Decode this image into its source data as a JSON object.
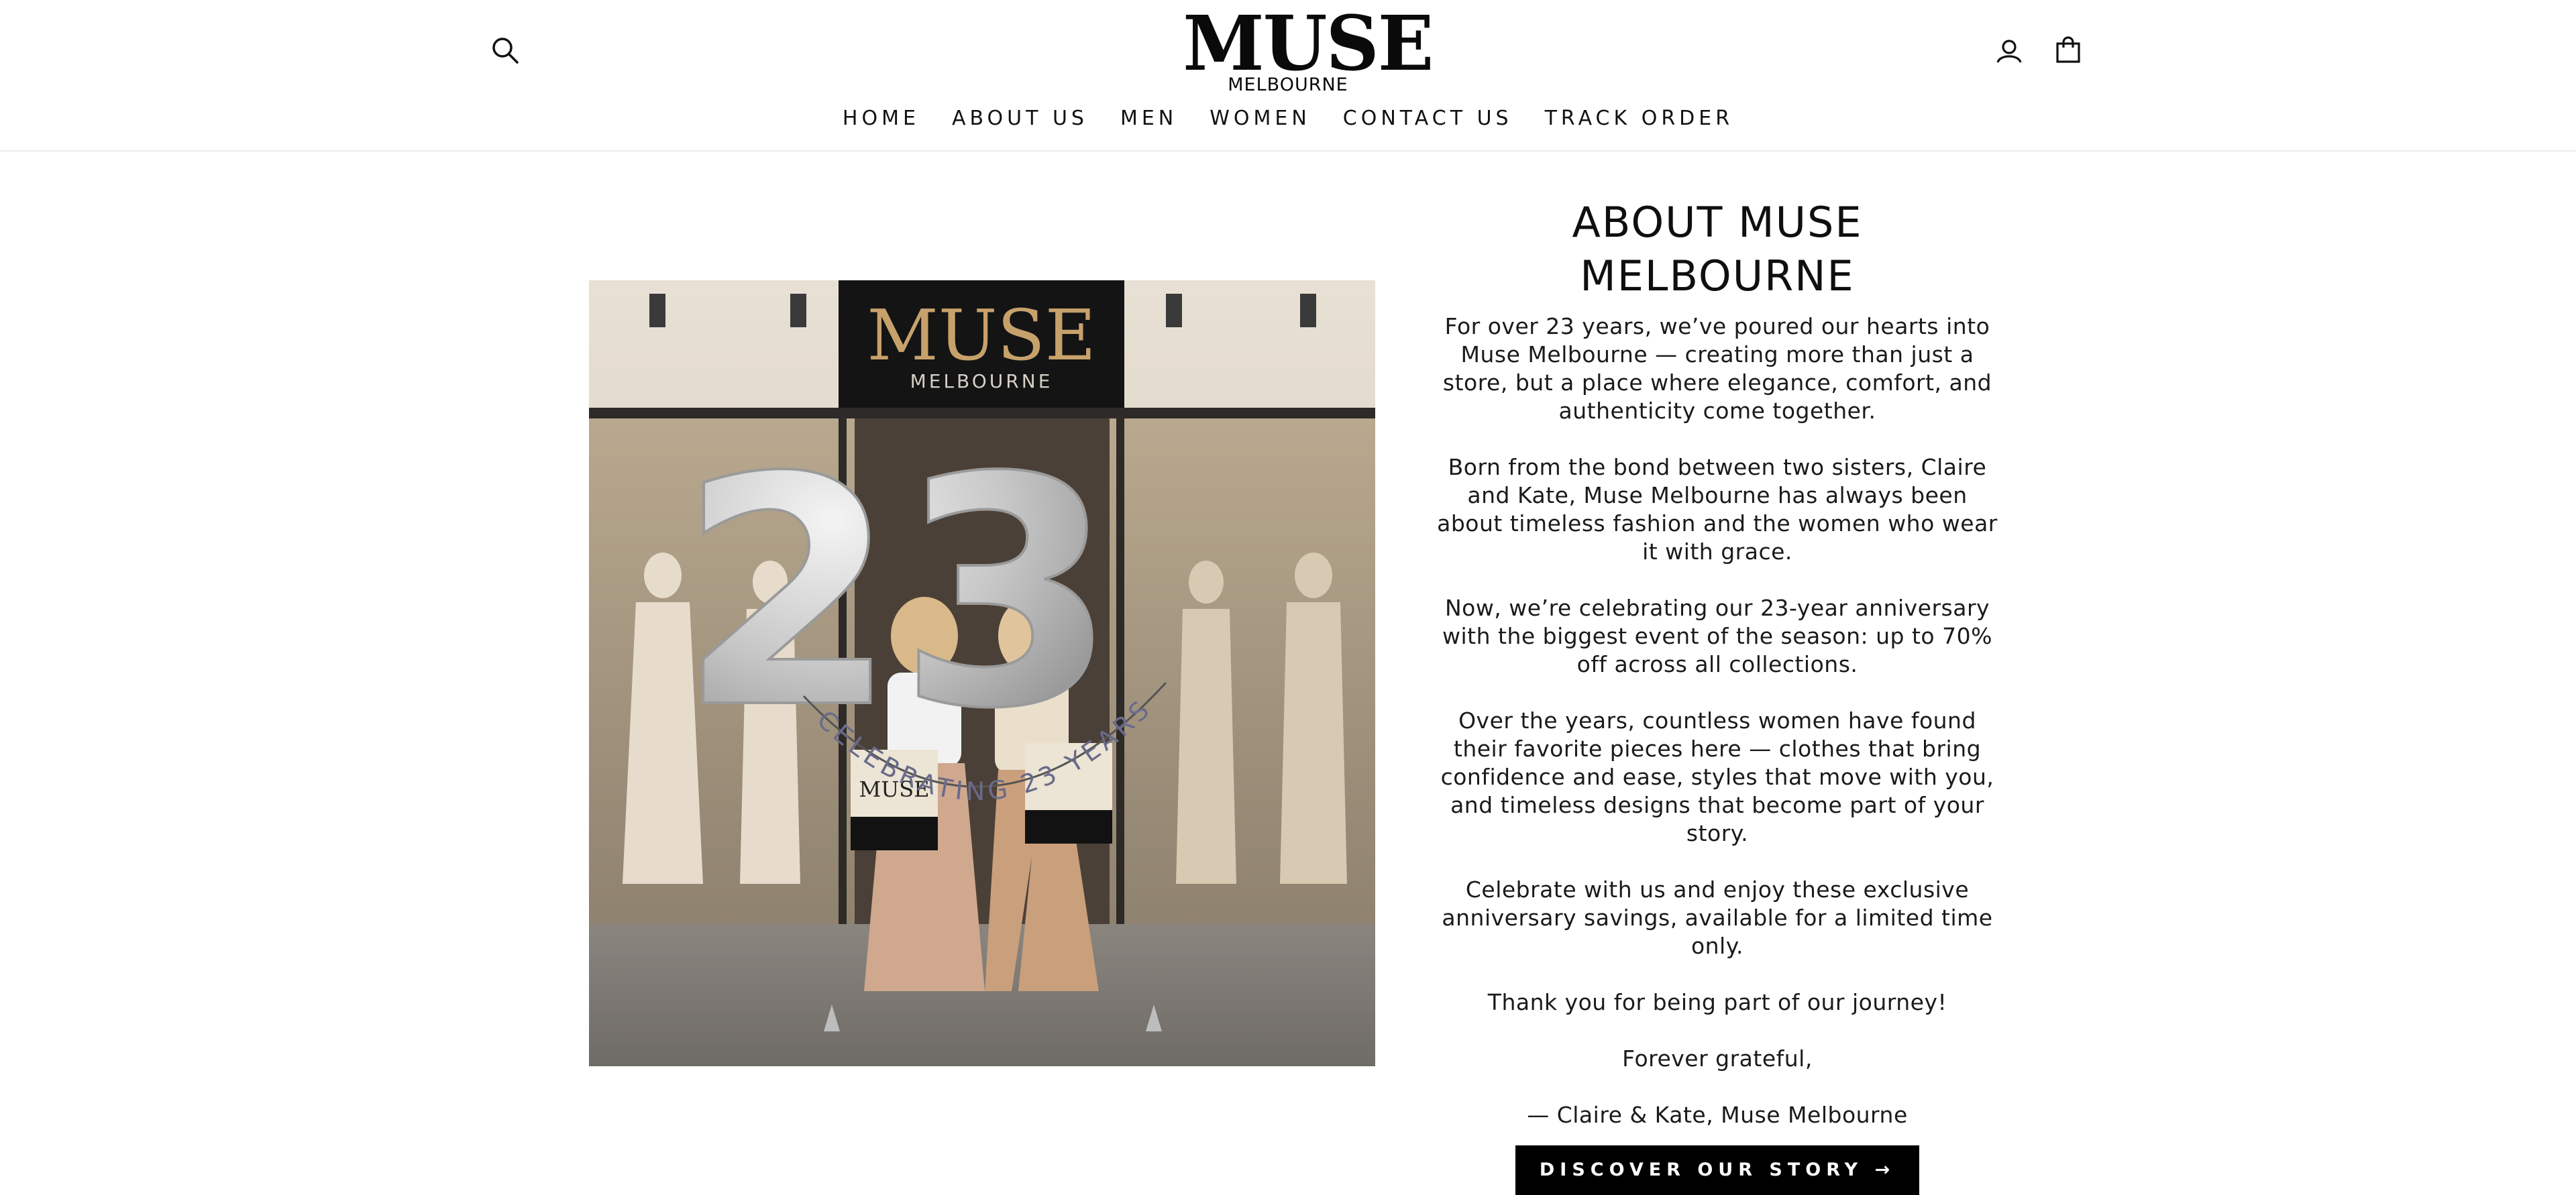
{
  "header": {
    "logo_main": "MUSE",
    "logo_sub": "MELBOURNE",
    "search_icon": "search-icon",
    "account_icon": "account-icon",
    "cart_icon": "shopping-bag-icon"
  },
  "nav": [
    {
      "label": "HOME"
    },
    {
      "label": "ABOUT US"
    },
    {
      "label": "MEN"
    },
    {
      "label": "WOMEN"
    },
    {
      "label": "CONTACT US"
    },
    {
      "label": "TRACK ORDER"
    }
  ],
  "photo": {
    "sign_main": "MUSE",
    "sign_sub": "MELBOURNE",
    "balloons": "23",
    "banner": "CELEBRATING 23 YEARS",
    "bag_text": "MUSE"
  },
  "about": {
    "title": "ABOUT MUSE MELBOURNE",
    "paragraphs": [
      "For over 23 years, we’ve poured our hearts into Muse Melbourne — creating more than just a store, but a place where elegance, comfort, and authenticity come together.",
      "Born from the bond between two sisters, Claire and Kate, Muse Melbourne has always been about timeless fashion and the women who wear it with grace.",
      "Now, we’re celebrating our 23-year anniversary with the biggest event of the season: up to 70% off across all collections.",
      "Over the years, countless women have found their favorite pieces here — clothes that bring confidence and ease, styles that move with you, and timeless designs that become part of your story.",
      "Celebrate with us and enjoy these exclusive anniversary savings, available for a limited time only.",
      "Thank you for being part of our journey!",
      "Forever grateful,",
      "— Claire & Kate, Muse Melbourne"
    ],
    "cta_label": "DISCOVER OUR STORY →"
  }
}
